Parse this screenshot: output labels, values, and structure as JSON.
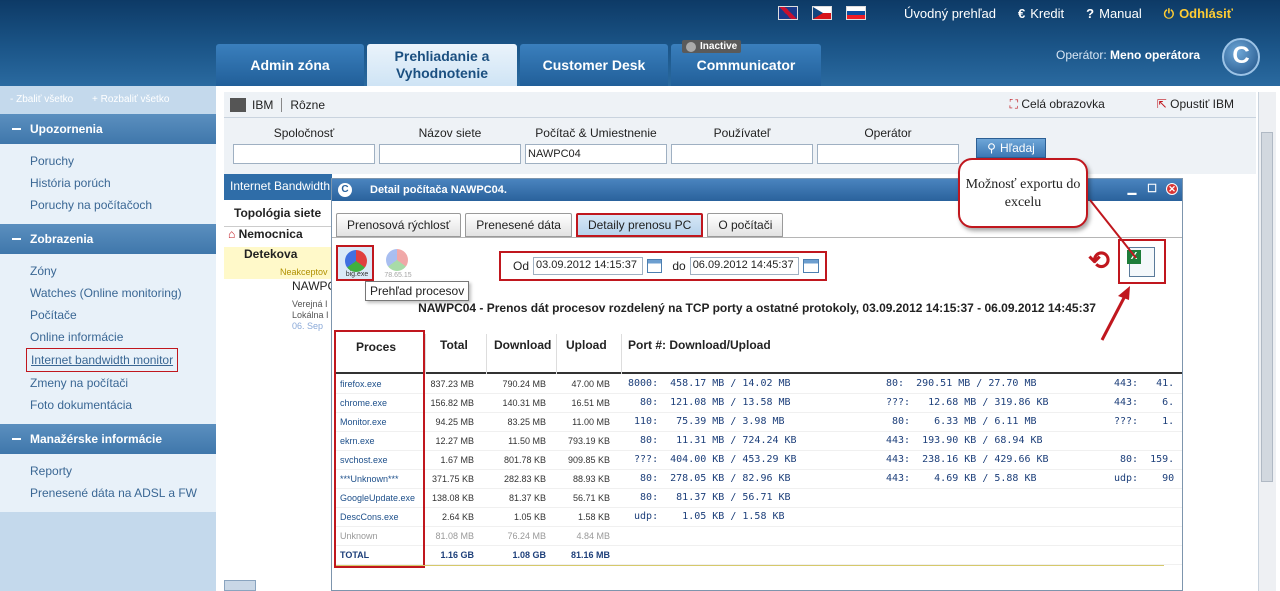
{
  "header": {
    "flags": [
      "uk-flag",
      "cz-flag",
      "sk-flag"
    ],
    "links": [
      "Úvodný prehľad",
      "Kredit",
      "Manual",
      "Odhlásiť"
    ],
    "link_icons": [
      "€",
      "?",
      "⏻"
    ],
    "operator_label": "Operátor:",
    "operator_name": "Meno operátora",
    "logo_letter": "C",
    "tabs": [
      {
        "label": "Admin zóna"
      },
      {
        "label1": "Prehliadanie a",
        "label2": "Vyhodnotenie"
      },
      {
        "label": "Customer Desk"
      },
      {
        "label": "Communicator",
        "badge": "Inactive"
      }
    ]
  },
  "sidebar": {
    "collapse_all": "- Zbaliť všetko",
    "expand_all": "+ Rozbaliť všetko",
    "sections": [
      {
        "title": "Upozornenia",
        "items": [
          "Poruchy",
          "História porúch",
          "Poruchy na počítačoch"
        ]
      },
      {
        "title": "Zobrazenia",
        "items": [
          "Zóny",
          "Watches (Online monitoring)",
          "Počítače",
          "Online informácie",
          "Internet bandwidth monitor",
          "Zmeny na počítači",
          "Foto dokumentácia"
        ]
      },
      {
        "title": "Manažérske informácie",
        "items": [
          "Reporty",
          "Prenesené dáta na ADSL a FW"
        ]
      }
    ]
  },
  "main": {
    "toolbar": {
      "ibm": "IBM",
      "various": "Rôzne",
      "fullscreen": "Celá obrazovka",
      "exit_ibm": "Opustiť IBM"
    },
    "filters": {
      "company": "Spoločnosť",
      "network": "Názov siete",
      "computer": "Počítač & Umiestnenie",
      "computer_value": "NAWPC04",
      "user": "Používateľ",
      "operator": "Operátor",
      "search": "Hľadaj"
    },
    "bw_title": "Internet Bandwidth",
    "topology_title": "Topológia siete",
    "tree": [
      "Nemocnica",
      "Detekova",
      "Neakceptov",
      "NAWPC",
      "Verejná I",
      "Lokálna I",
      "06. Sep"
    ]
  },
  "modal": {
    "title": "Detail počítača NAWPC04.",
    "tabs": [
      "Prenosová rýchlosť",
      "Prenesené dáta",
      "Detaily prenosu PC",
      "O počítači"
    ],
    "chart_icon_captions": [
      "big.exe",
      "78.65.15"
    ],
    "tooltip": "Prehľad procesov",
    "date_from_label": "Od",
    "date_from": "03.09.2012 14:15:37",
    "date_to_label": "do",
    "date_to": "06.09.2012 14:45:37",
    "subtitle": "NAWPC04 - Prenos dát procesov rozdelený na TCP porty a ostatné protokoly, 03.09.2012 14:15:37 - 06.09.2012 14:45:37",
    "columns": [
      "Proces",
      "Total",
      "Download",
      "Upload",
      "Port #: Download/Upload"
    ],
    "rows": [
      {
        "proc": "firefox.exe",
        "total": "837.23 MB",
        "down": "790.24 MB",
        "up": "47.00 MB",
        "p1": "8000:  458.17 MB / 14.02 MB",
        "p2": "80:  290.51 MB / 27.70 MB",
        "p3": "443:   41."
      },
      {
        "proc": "chrome.exe",
        "total": "156.82 MB",
        "down": "140.31 MB",
        "up": "16.51 MB",
        "p1": "  80:  121.08 MB / 13.58 MB",
        "p2": "???:   12.68 MB / 319.86 KB",
        "p3": "443:    6."
      },
      {
        "proc": "Monitor.exe",
        "total": "94.25 MB",
        "down": "83.25 MB",
        "up": "11.00 MB",
        "p1": " 110:   75.39 MB / 3.98 MB",
        "p2": " 80:    6.33 MB / 6.11 MB",
        "p3": "???:    1."
      },
      {
        "proc": "ekrn.exe",
        "total": "12.27 MB",
        "down": "11.50 MB",
        "up": "793.19 KB",
        "p1": "  80:   11.31 MB / 724.24 KB",
        "p2": "443:  193.90 KB / 68.94 KB",
        "p3": ""
      },
      {
        "proc": "svchost.exe",
        "total": "1.67 MB",
        "down": "801.78 KB",
        "up": "909.85 KB",
        "p1": " ???:  404.00 KB / 453.29 KB",
        "p2": "443:  238.16 KB / 429.66 KB",
        "p3": " 80:  159."
      },
      {
        "proc": "***Unknown***",
        "total": "371.75 KB",
        "down": "282.83 KB",
        "up": "88.93 KB",
        "p1": "  80:  278.05 KB / 82.96 KB",
        "p2": "443:    4.69 KB / 5.88 KB",
        "p3": "udp:    90"
      },
      {
        "proc": "GoogleUpdate.exe",
        "total": "138.08 KB",
        "down": "81.37 KB",
        "up": "56.71 KB",
        "p1": "  80:   81.37 KB / 56.71 KB",
        "p2": "",
        "p3": ""
      },
      {
        "proc": "DescCons.exe",
        "total": "2.64 KB",
        "down": "1.05 KB",
        "up": "1.58 KB",
        "p1": " udp:    1.05 KB / 1.58 KB",
        "p2": "",
        "p3": ""
      },
      {
        "proc": "Unknown",
        "total": "81.08 MB",
        "down": "76.24 MB",
        "up": "4.84 MB",
        "p1": "",
        "p2": "",
        "p3": ""
      },
      {
        "proc": "TOTAL",
        "total": "1.16 GB",
        "down": "1.08 GB",
        "up": "81.16 MB",
        "p1": "",
        "p2": "",
        "p3": ""
      }
    ]
  },
  "callout": {
    "line1": "Možnosť exportu do",
    "line2": "excelu"
  },
  "colors": {
    "accent_red": "#c0171e",
    "header_blue": "#1b5588",
    "sidebar_bg": "#c4d9ec"
  }
}
